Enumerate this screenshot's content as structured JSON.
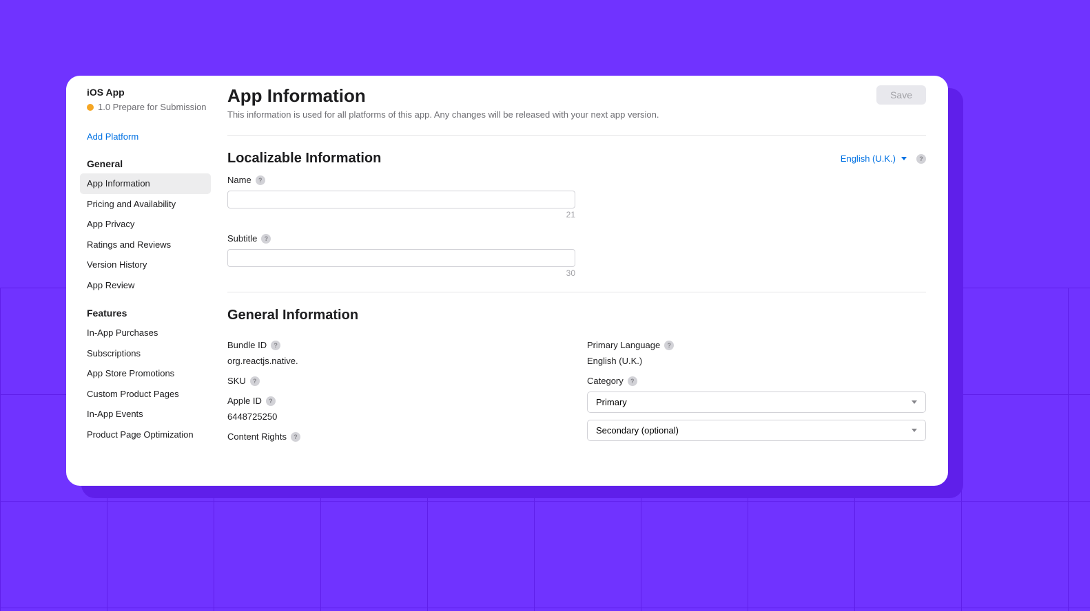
{
  "sidebar": {
    "platform_title": "iOS App",
    "version_status": "1.0 Prepare for Submission",
    "add_platform": "Add Platform",
    "groups": [
      {
        "title": "General",
        "items": [
          {
            "label": "App Information",
            "active": true
          },
          {
            "label": "Pricing and Availability",
            "active": false
          },
          {
            "label": "App Privacy",
            "active": false
          },
          {
            "label": "Ratings and Reviews",
            "active": false
          },
          {
            "label": "Version History",
            "active": false
          },
          {
            "label": "App Review",
            "active": false
          }
        ]
      },
      {
        "title": "Features",
        "items": [
          {
            "label": "In-App Purchases",
            "active": false
          },
          {
            "label": "Subscriptions",
            "active": false
          },
          {
            "label": "App Store Promotions",
            "active": false
          },
          {
            "label": "Custom Product Pages",
            "active": false
          },
          {
            "label": "In-App Events",
            "active": false
          },
          {
            "label": "Product Page Optimization",
            "active": false
          }
        ]
      }
    ]
  },
  "header": {
    "title": "App Information",
    "subtitle": "This information is used for all platforms of this app. Any changes will be released with your next app version.",
    "save_label": "Save"
  },
  "localizable": {
    "section_title": "Localizable Information",
    "locale": "English (U.K.)",
    "name_label": "Name",
    "name_value": "",
    "name_counter": "21",
    "subtitle_label": "Subtitle",
    "subtitle_value": "",
    "subtitle_counter": "30"
  },
  "general": {
    "section_title": "General Information",
    "bundle_id_label": "Bundle ID",
    "bundle_id_value": "org.reactjs.native.",
    "sku_label": "SKU",
    "sku_value": "",
    "apple_id_label": "Apple ID",
    "apple_id_value": "6448725250",
    "content_rights_label": "Content Rights",
    "primary_language_label": "Primary Language",
    "primary_language_value": "English (U.K.)",
    "category_label": "Category",
    "category_primary_placeholder": "Primary",
    "category_secondary_placeholder": "Secondary (optional)"
  }
}
